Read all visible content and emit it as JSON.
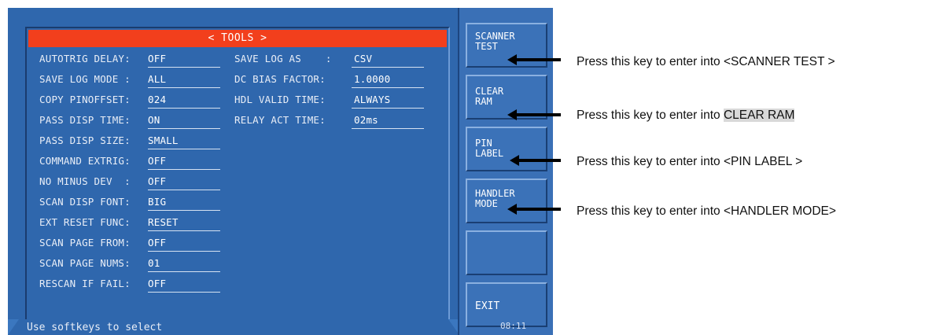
{
  "screen": {
    "title": "< TOOLS >",
    "status_text": "Use softkeys to select",
    "clock": "08:11"
  },
  "left_fields": [
    {
      "label": "AUTOTRIG DELAY:",
      "value": "OFF"
    },
    {
      "label": "SAVE LOG MODE :",
      "value": "ALL"
    },
    {
      "label": "COPY PINOFFSET:",
      "value": "024"
    },
    {
      "label": "PASS DISP TIME:",
      "value": "ON"
    },
    {
      "label": "PASS DISP SIZE:",
      "value": "SMALL"
    },
    {
      "label": "COMMAND EXTRIG:",
      "value": "OFF"
    },
    {
      "label": "NO MINUS DEV  :",
      "value": "OFF"
    },
    {
      "label": "SCAN DISP FONT:",
      "value": "BIG"
    },
    {
      "label": "EXT RESET FUNC:",
      "value": "RESET"
    },
    {
      "label": "SCAN PAGE FROM:",
      "value": "OFF"
    },
    {
      "label": "SCAN PAGE NUMS:",
      "value": "01"
    },
    {
      "label": "RESCAN IF FAIL:",
      "value": "OFF"
    }
  ],
  "right_fields": [
    {
      "label": "SAVE LOG AS    :",
      "value": "CSV"
    },
    {
      "label": "DC BIAS FACTOR:",
      "value": "1.0000"
    },
    {
      "label": "HDL VALID TIME:",
      "value": "ALWAYS"
    },
    {
      "label": "RELAY ACT TIME:",
      "value": "02ms"
    }
  ],
  "softkeys": [
    {
      "line1": "SCANNER",
      "line2": "TEST"
    },
    {
      "line1": "CLEAR",
      "line2": "RAM"
    },
    {
      "line1": "PIN",
      "line2": "LABEL"
    },
    {
      "line1": "HANDLER",
      "line2": "MODE"
    },
    {
      "line1": "",
      "line2": ""
    },
    {
      "line1": "EXIT",
      "line2": ""
    }
  ],
  "annotations": [
    {
      "prefix": "Press this key to enter into ",
      "target": "<SCANNER TEST >"
    },
    {
      "prefix": "Press this key to enter into ",
      "target": "CLEAR RAM"
    },
    {
      "prefix": "Press this key to enter into ",
      "target": "<PIN LABEL >"
    },
    {
      "prefix": "Press this key to enter into ",
      "target": "<HANDLER MODE>"
    }
  ]
}
